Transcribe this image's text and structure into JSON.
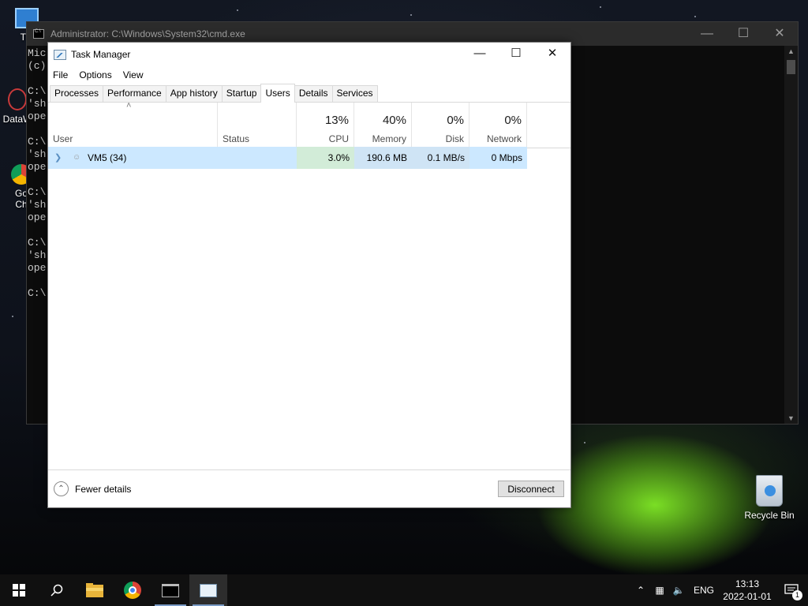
{
  "desktop": {
    "icons": [
      {
        "label": "Thi",
        "icon": "this-pc-icon"
      },
      {
        "label": "DataW",
        "icon": "datawrapper-icon"
      },
      {
        "label": "Go\nCh",
        "icon": "chrome-icon"
      },
      {
        "label": "Recycle Bin",
        "icon": "recycle-bin-icon"
      }
    ]
  },
  "cmd": {
    "title": "Administrator: C:\\Windows\\System32\\cmd.exe",
    "lines": [
      "Mic",
      "(c)",
      "",
      "C:\\",
      "'sh",
      "ope",
      "",
      "C:\\",
      "'sh",
      "ope",
      "",
      "C:\\",
      "'sh",
      "ope",
      "",
      "C:\\",
      "'sh",
      "ope",
      "",
      "C:\\"
    ]
  },
  "taskmanager": {
    "title": "Task Manager",
    "menu": [
      "File",
      "Options",
      "View"
    ],
    "tabs": [
      "Processes",
      "Performance",
      "App history",
      "Startup",
      "Users",
      "Details",
      "Services"
    ],
    "active_tab": "Users",
    "columns": {
      "user": "User",
      "status": "Status",
      "cpu": {
        "pct": "13%",
        "label": "CPU"
      },
      "memory": {
        "pct": "40%",
        "label": "Memory"
      },
      "disk": {
        "pct": "0%",
        "label": "Disk"
      },
      "network": {
        "pct": "0%",
        "label": "Network"
      }
    },
    "rows": [
      {
        "user": "VM5 (34)",
        "status": "",
        "cpu": "3.0%",
        "memory": "190.6 MB",
        "disk": "0.1 MB/s",
        "network": "0 Mbps"
      }
    ],
    "footer": {
      "fewer_details": "Fewer details",
      "disconnect": "Disconnect"
    }
  },
  "taskbar": {
    "apps": [
      "start-icon",
      "search-icon",
      "file-explorer-icon",
      "chrome-icon",
      "cmd-icon",
      "task-manager-icon"
    ],
    "tray": {
      "language": "ENG",
      "time": "13:13",
      "date": "2022-01-01",
      "notification_count": "1"
    }
  },
  "colors": {
    "selection": "#cce8ff",
    "taskbar": "#101010",
    "accent": "#0078d7"
  }
}
